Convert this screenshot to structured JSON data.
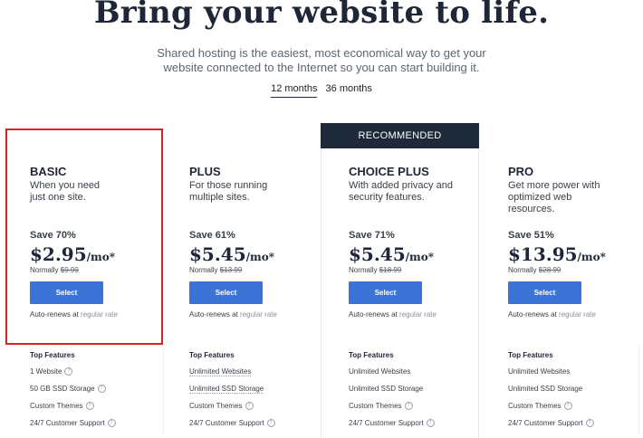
{
  "header": {
    "title": "Bring your website to life.",
    "subtitle_line1": "Shared hosting is the easiest, most economical way to get your",
    "subtitle_line2": "website connected to the Internet so you can start building it."
  },
  "terms": [
    {
      "label": "12 months",
      "active": true
    },
    {
      "label": "36 months",
      "active": false
    }
  ],
  "recommended_label": "RECOMMENDED",
  "features_title": "Top Features",
  "select_label": "Select",
  "renew_prefix": "Auto-renews at",
  "renew_link": "regular rate",
  "normally_prefix": "Normally",
  "colors": {
    "accent": "#3b73d6",
    "banner": "#1e2a3a",
    "highlight": "#d42424"
  },
  "plans": [
    {
      "name": "BASIC",
      "desc": "When you need just one site.",
      "save": "Save 70%",
      "price": "$2.95",
      "unit": "/mo*",
      "normally": "$9.99",
      "features": [
        "1 Website",
        "50 GB SSD Storage",
        "Custom Themes",
        "24/7 Customer Support"
      ]
    },
    {
      "name": "PLUS",
      "desc": "For those running multiple sites.",
      "save": "Save 61%",
      "price": "$5.45",
      "unit": "/mo*",
      "normally": "$13.99",
      "features": [
        "Unlimited Websites",
        "Unlimited SSD Storage",
        "Custom Themes",
        "24/7 Customer Support"
      ]
    },
    {
      "name": "CHOICE PLUS",
      "desc": "With added privacy and security features.",
      "save": "Save 71%",
      "price": "$5.45",
      "unit": "/mo*",
      "normally": "$18.99",
      "features": [
        "Unlimited Websites",
        "Unlimited SSD Storage",
        "Custom Themes",
        "24/7 Customer Support"
      ]
    },
    {
      "name": "PRO",
      "desc": "Get more power with optimized web resources.",
      "save": "Save 51%",
      "price": "$13.95",
      "unit": "/mo*",
      "normally": "$28.99",
      "features": [
        "Unlimited Websites",
        "Unlimited SSD Storage",
        "Custom Themes",
        "24/7 Customer Support"
      ]
    }
  ]
}
